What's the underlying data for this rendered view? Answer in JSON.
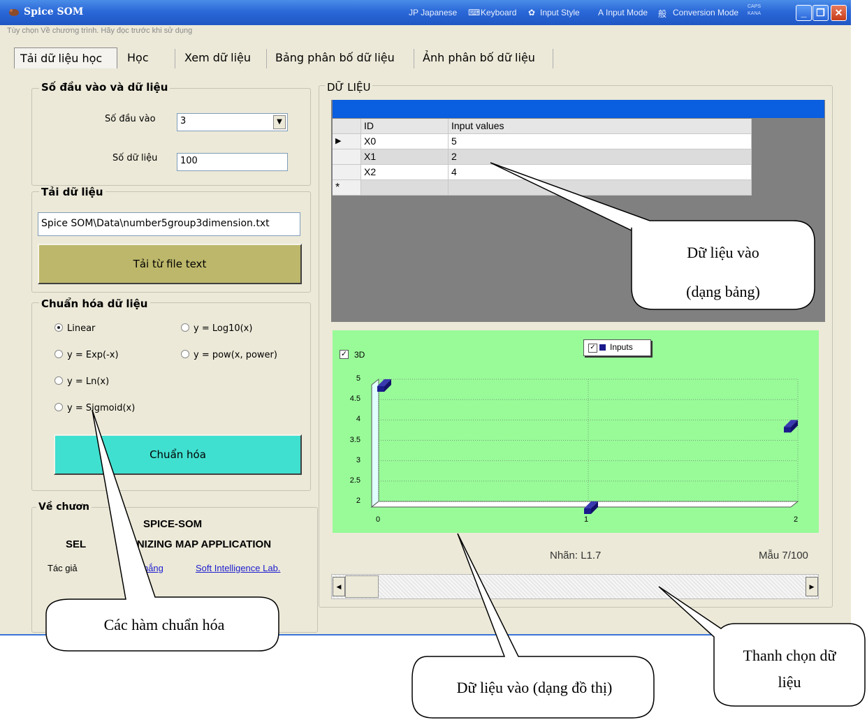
{
  "window": {
    "title": "Spice SOM",
    "ime": {
      "jp": "JP Japanese",
      "keyboard": "Keyboard",
      "input_style": "Input Style",
      "input_mode": "Input Mode",
      "conversion_mode": "Conversion Mode",
      "caps": "CAPS",
      "kana": "KANA"
    }
  },
  "menu": "Tùy chọn   Về chương trình. Hãy đọc trước khi sử dụng",
  "tabs": [
    "Tải dữ liệu học",
    "Học",
    "Xem dữ liệu",
    "Bảng phân bố dữ liệu",
    "Ảnh phân bố dữ liệu"
  ],
  "inputs_group": {
    "title": "Số đầu vào và dữ liệu",
    "num_inputs_label": "Số đầu vào",
    "num_inputs_value": "3",
    "num_data_label": "Số dữ liệu",
    "num_data_value": "100"
  },
  "load_group": {
    "title": "Tải dữ liệu",
    "file_path": "Spice SOM\\Data\\number5group3dimension.txt",
    "load_button": "Tải từ file text"
  },
  "normalize_group": {
    "title": "Chuẩn hóa dữ liệu",
    "options": [
      "Linear",
      "y = Log10(x)",
      "y = Exp(-x)",
      "y = pow(x, power)",
      "y = Ln(x)",
      "y = Sigmoid(x)"
    ],
    "selected": "Linear",
    "button": "Chuẩn hóa"
  },
  "about_group": {
    "title": "Về chươn",
    "line1": "SPICE-SOM",
    "line2_a": "SEL",
    "line2_b": "ANIZING MAP APPLICATION",
    "author_label": "Tác giả",
    "author_link": "Thắng",
    "lab_link": "Soft Intelligence Lab."
  },
  "data_group": {
    "title": "DỮ LIỆU",
    "columns": [
      "ID",
      "Input values"
    ],
    "rows": [
      {
        "id": "X0",
        "value": "5"
      },
      {
        "id": "X1",
        "value": "2"
      },
      {
        "id": "X2",
        "value": "4"
      }
    ],
    "row_marker": "▶",
    "new_row_marker": "*"
  },
  "chart_data": {
    "type": "bar",
    "view_3d": true,
    "view_3d_label": "3D",
    "legend": "Inputs",
    "categories": [
      "0",
      "1",
      "2"
    ],
    "values": [
      5,
      2,
      4
    ],
    "ylim": [
      2,
      5
    ],
    "yticks": [
      "5",
      "4.5",
      "4",
      "3.5",
      "3",
      "2.5",
      "2"
    ],
    "color": "#1a1a8c",
    "background": "#98fb98"
  },
  "status": {
    "label": "Nhãn: L1.7",
    "sample": "Mẫu 7/100"
  },
  "callouts": {
    "table": [
      "Dữ liệu vào",
      "(dạng bảng)"
    ],
    "normalize": "Các hàm chuẩn hóa",
    "chart": "Dữ liệu vào (dạng đồ thị)",
    "scrollbar": [
      "Thanh chọn dữ",
      "liệu"
    ]
  }
}
